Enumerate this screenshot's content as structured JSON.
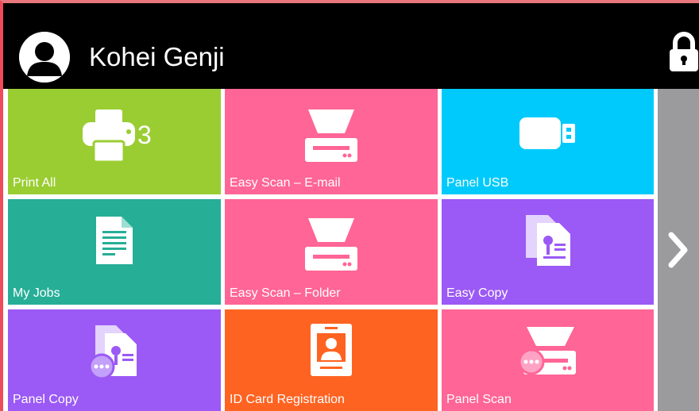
{
  "header": {
    "user_name": "Kohei Genji",
    "avatar_icon": "user-avatar-icon",
    "lock_icon": "lock-icon"
  },
  "tiles": [
    {
      "label": "Print All",
      "icon": "printer-icon",
      "badge": "3",
      "color": "#9acd32"
    },
    {
      "label": "Easy Scan – E-mail",
      "icon": "scanner-icon",
      "color": "#ff6596"
    },
    {
      "label": "Panel USB",
      "icon": "usb-drive-icon",
      "color": "#00cafc"
    },
    {
      "label": "My Jobs",
      "icon": "document-icon",
      "color": "#27ae97"
    },
    {
      "label": "Easy Scan – Folder",
      "icon": "scanner-icon",
      "color": "#ff6596"
    },
    {
      "label": "Easy Copy",
      "icon": "copy-documents-icon",
      "color": "#9b59f5"
    },
    {
      "label": "Panel Copy",
      "icon": "panel-copy-icon",
      "color": "#9b59f5"
    },
    {
      "label": "ID Card Registration",
      "icon": "id-card-icon",
      "color": "#ff6321"
    },
    {
      "label": "Panel Scan",
      "icon": "panel-scan-icon",
      "color": "#ff6596"
    }
  ],
  "navigation": {
    "next_icon": "chevron-right-icon"
  }
}
